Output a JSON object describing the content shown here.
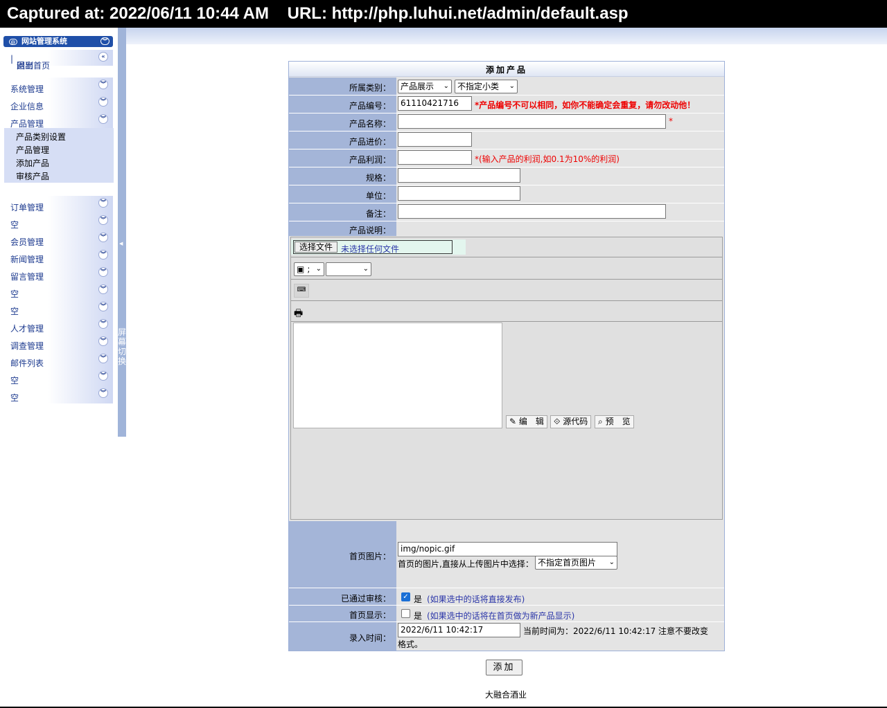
{
  "capture": {
    "text": "Captured at: 2022/06/11 10:44 AM    URL: http://php.luhui.net/admin/default.asp"
  },
  "sidebar": {
    "title": "网站管理系统",
    "home_link": "回到首页",
    "separator": "|",
    "logout_link": "退出",
    "sections": [
      {
        "label": "系统管理"
      },
      {
        "label": "企业信息"
      },
      {
        "label": "产品管理"
      },
      {
        "label": "订单管理"
      },
      {
        "label": "空"
      },
      {
        "label": "会员管理"
      },
      {
        "label": "新闻管理"
      },
      {
        "label": "留言管理"
      },
      {
        "label": "空"
      },
      {
        "label": "空"
      },
      {
        "label": "人才管理"
      },
      {
        "label": "调查管理"
      },
      {
        "label": "邮件列表"
      },
      {
        "label": "空"
      },
      {
        "label": "空"
      }
    ],
    "submenu": [
      "产品类别设置",
      "产品管理",
      "添加产品",
      "审核产品"
    ],
    "splitter_text": "屏幕切换"
  },
  "form": {
    "title": "添加产品",
    "category_label": "所属类别：",
    "category_value": "产品展示",
    "subcategory_value": "不指定小类",
    "code_label": "产品编号：",
    "code_value": "61110421716",
    "code_note": "*产品编号不可以相同，如你不能确定会重复，请勿改动他！",
    "name_label": "产品名称：",
    "name_value": "",
    "required_mark": "*",
    "cost_label": "产品进价：",
    "profit_label": "产品利润：",
    "profit_note": "*(输入产品的利润,如0.1为10%的利润)",
    "spec_label": "规格：",
    "unit_label": "单位：",
    "remark_label": "备注：",
    "desc_label": "产品说明：",
    "homepic_label": "首页图片：",
    "homepic_value": "img/nopic.gif",
    "homepic_hint": "首页的图片,直接从上传图片中选择：",
    "homepic_select": "不指定首页图片",
    "approved_label": "已通过审核：",
    "approved_yes": "是",
    "approved_note": "(如果选中的话将直接发布)",
    "home_show_label": "首页显示：",
    "home_show_yes": "是",
    "home_show_note": "(如果选中的话将在首页做为新产品显示)",
    "time_label": "录入时间：",
    "time_value": "2022/6/11 10:42:17",
    "time_note": "当前时间为：2022/6/11 10:42:17 注意不要改变格式。"
  },
  "editor": {
    "file_button": "选择文件",
    "file_status": "未选择任何文件",
    "font_select": ";",
    "mode_edit": "编　辑",
    "mode_source": "源代码",
    "mode_preview": "预　览"
  },
  "submit_label": "添加",
  "footer": "大融合酒业",
  "colors": {
    "accent": "#1f4fa8",
    "label_bg": "#a4b5d8",
    "form_bg": "#e4e4e4",
    "warning": "#e00000",
    "note": "#2a35a8"
  }
}
